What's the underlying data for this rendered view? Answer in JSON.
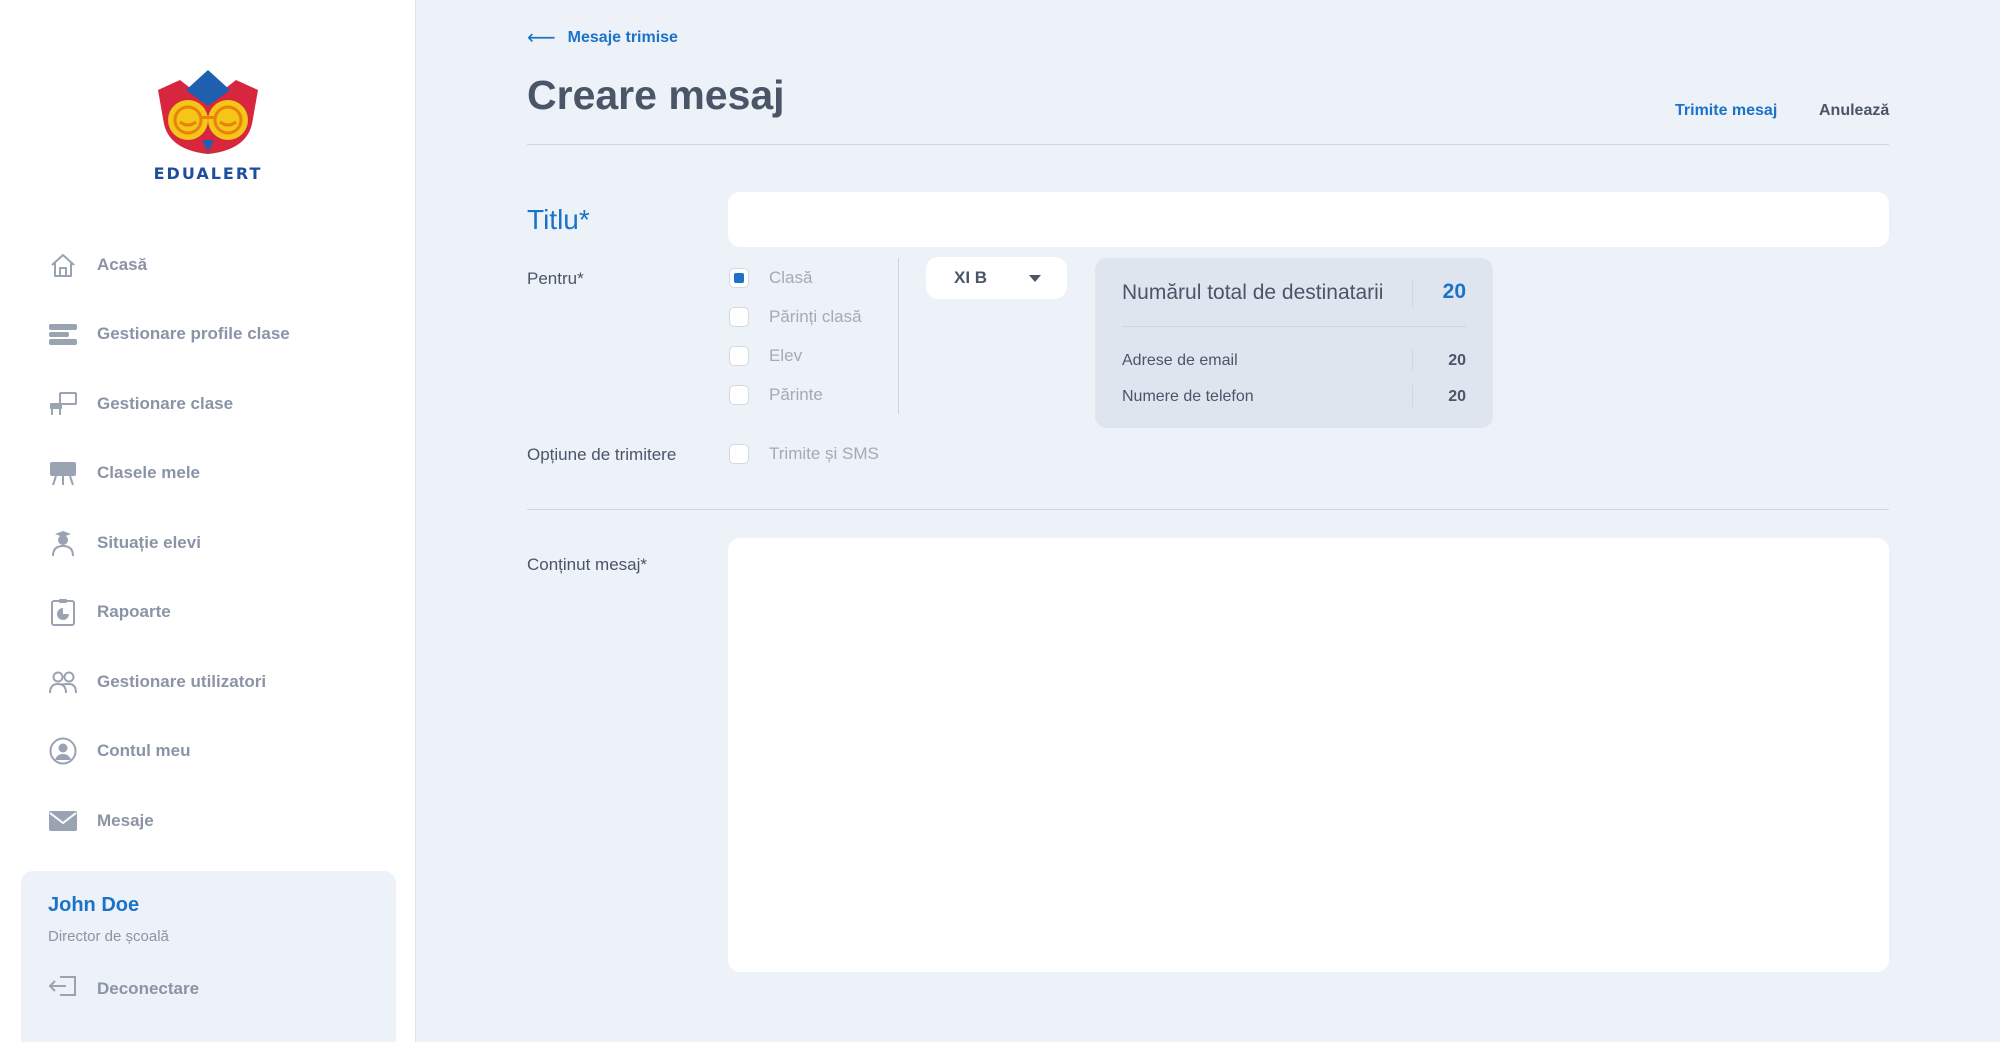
{
  "brand": {
    "name": "EDUALERT"
  },
  "sidebar": {
    "items": [
      {
        "label": "Acasă",
        "icon": "home-icon"
      },
      {
        "label": "Gestionare profile clase",
        "icon": "class-profiles-icon"
      },
      {
        "label": "Gestionare clase",
        "icon": "classroom-icon"
      },
      {
        "label": "Clasele mele",
        "icon": "board-icon"
      },
      {
        "label": "Situație elevi",
        "icon": "student-icon"
      },
      {
        "label": "Rapoarte",
        "icon": "report-icon"
      },
      {
        "label": "Gestionare utilizatori",
        "icon": "users-icon"
      },
      {
        "label": "Contul meu",
        "icon": "account-icon"
      },
      {
        "label": "Mesaje",
        "icon": "mail-icon"
      }
    ]
  },
  "user": {
    "name": "John Doe",
    "role": "Director de școală",
    "logout_label": "Deconectare"
  },
  "header": {
    "back_label": "Mesaje trimise",
    "title": "Creare mesaj",
    "send_label": "Trimite mesaj",
    "cancel_label": "Anulează"
  },
  "form": {
    "title_label": "Titlu*",
    "title_value": "",
    "for_label": "Pentru*",
    "recipient_options": [
      {
        "label": "Clasă",
        "checked": true
      },
      {
        "label": "Părinți clasă",
        "checked": false
      },
      {
        "label": "Elev",
        "checked": false
      },
      {
        "label": "Părinte",
        "checked": false
      }
    ],
    "class_selected": "XI B",
    "send_option_label": "Opțiune de trimitere",
    "sms_option": {
      "label": "Trimite și SMS",
      "checked": false
    },
    "content_label": "Conținut mesaj*",
    "content_value": ""
  },
  "recipients_summary": {
    "total_label": "Numărul total de destinatarii",
    "total_value": "20",
    "email_label": "Adrese de email",
    "email_value": "20",
    "phone_label": "Numere de telefon",
    "phone_value": "20"
  },
  "colors": {
    "accent": "#1a73c9",
    "background": "#edf1f8",
    "text": "#4a5568",
    "muted": "#8a94a6"
  }
}
